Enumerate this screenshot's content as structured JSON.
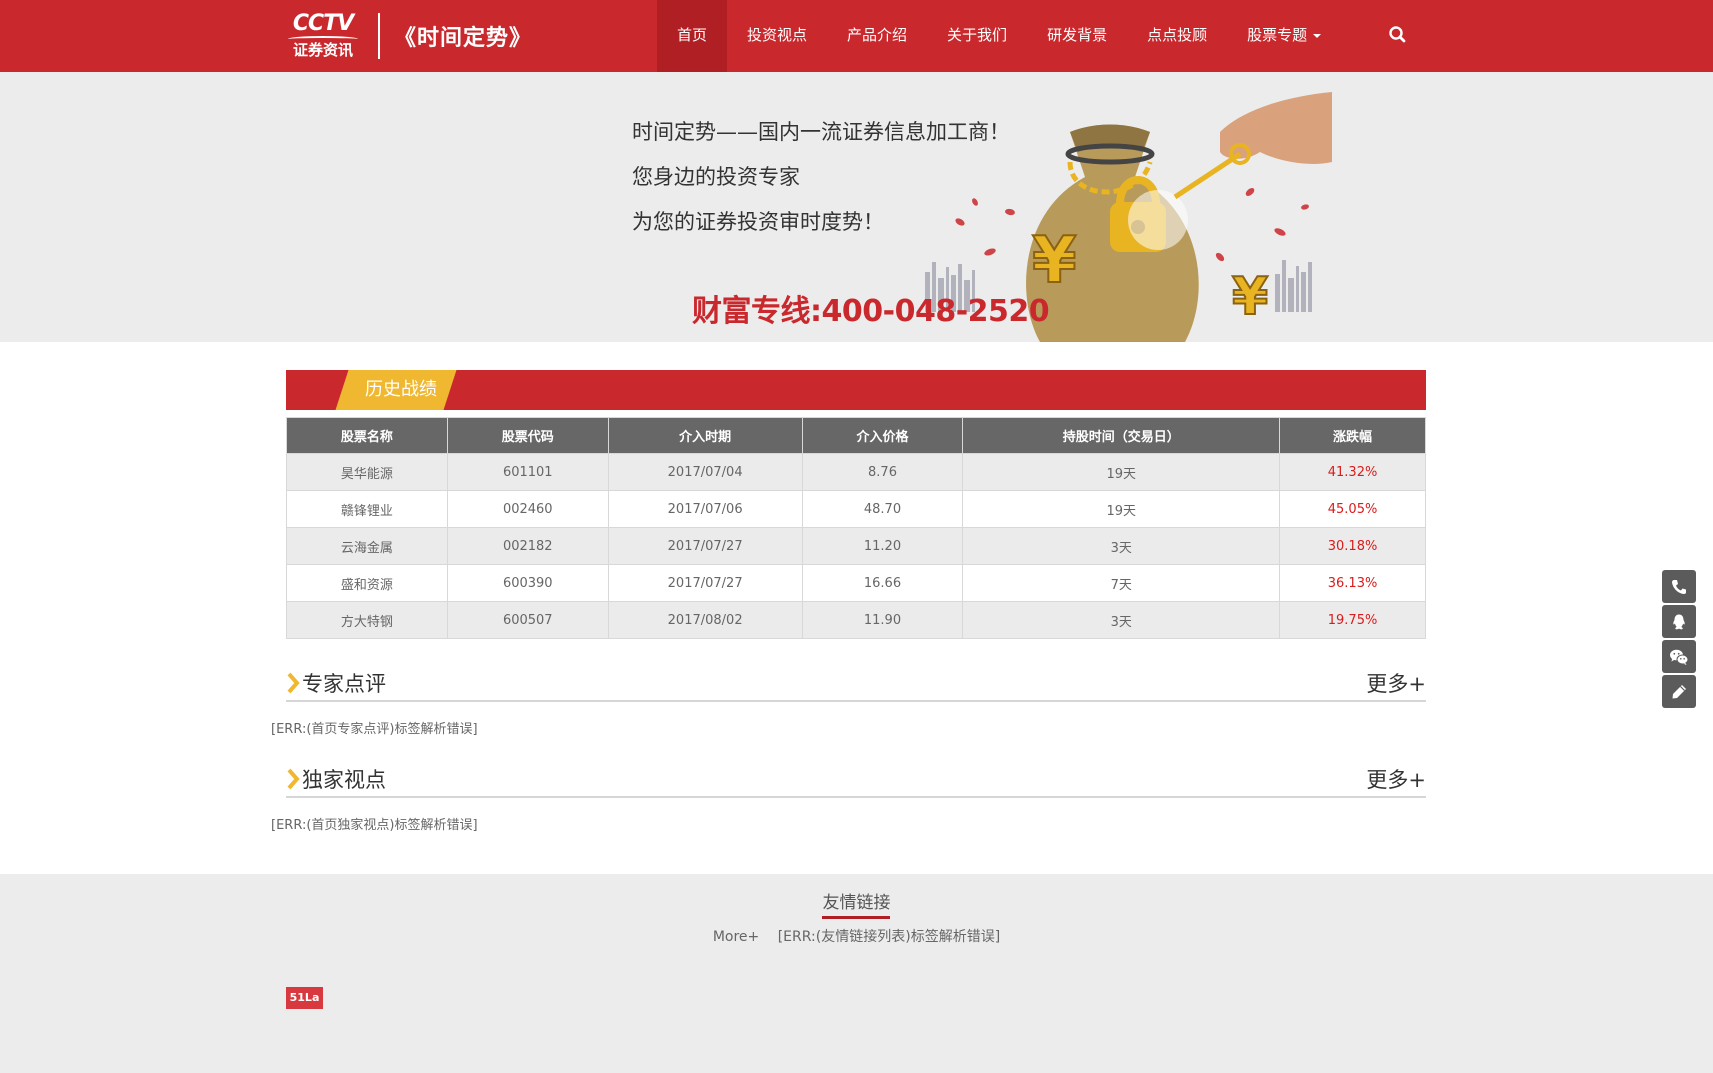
{
  "header": {
    "logo_cctv": "CCTV",
    "logo_sub": "证券资讯",
    "title": "《时间定势》",
    "nav": [
      {
        "label": "首页",
        "active": true
      },
      {
        "label": "投资视点"
      },
      {
        "label": "产品介绍"
      },
      {
        "label": "关于我们"
      },
      {
        "label": "研发背景"
      },
      {
        "label": "点点投顾"
      },
      {
        "label": "股票专题",
        "dropdown": true
      }
    ],
    "search_icon": "search-icon"
  },
  "banner": {
    "lines": [
      "时间定势——国内一流证券信息加工商！",
      "您身边的投资专家",
      "为您的证券投资审时度势！"
    ],
    "hotline": "财富专线:400-048-2520",
    "art_glyph": "¥"
  },
  "history": {
    "title": "历史战绩",
    "headers": [
      "股票名称",
      "股票代码",
      "介入时期",
      "介入价格",
      "持股时间（交易日）",
      "涨跌幅"
    ],
    "rows": [
      [
        "昊华能源",
        "601101",
        "2017/07/04",
        "8.76",
        "19天",
        "41.32%"
      ],
      [
        "赣锋锂业",
        "002460",
        "2017/07/06",
        "48.70",
        "19天",
        "45.05%"
      ],
      [
        "云海金属",
        "002182",
        "2017/07/27",
        "11.20",
        "3天",
        "30.18%"
      ],
      [
        "盛和资源",
        "600390",
        "2017/07/27",
        "16.66",
        "7天",
        "36.13%"
      ],
      [
        "方大特钢",
        "600507",
        "2017/08/02",
        "11.90",
        "3天",
        "19.75%"
      ]
    ]
  },
  "expert": {
    "title": "专家点评",
    "more": "更多+",
    "error": "[ERR:(首页专家点评)标签解析错误]"
  },
  "exclusive": {
    "title": "独家视点",
    "more": "更多+",
    "error": "[ERR:(首页独家视点)标签解析错误]"
  },
  "footer": {
    "friend_title": "友情链接",
    "more": "More+",
    "error": "[ERR:(友情链接列表)标签解析错误]",
    "badge": "51La"
  },
  "side_tools": [
    "phone-icon",
    "qq-icon",
    "wechat-icon",
    "edit-icon"
  ],
  "colors": {
    "brand_red": "#c9282d",
    "accent_gold": "#f0b731",
    "table_head": "#676767",
    "pct_red": "#d91c1c"
  }
}
